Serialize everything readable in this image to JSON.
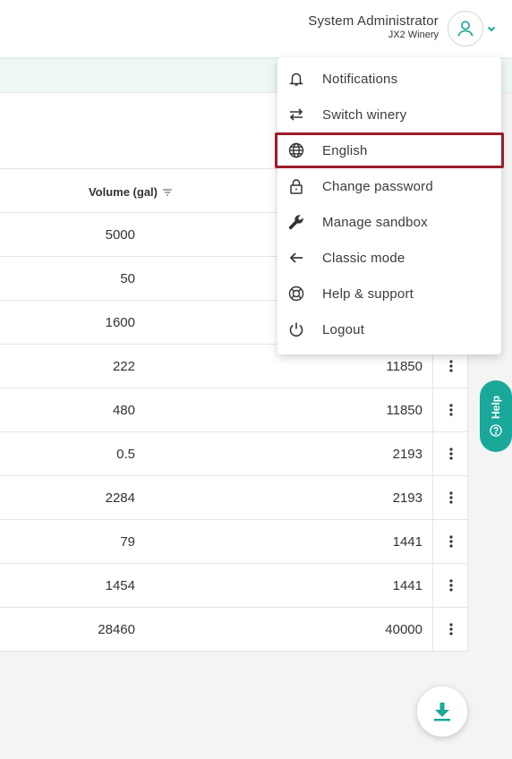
{
  "header": {
    "user_name": "System Administrator",
    "winery": "JX2 Winery"
  },
  "table": {
    "volume_header": "Volume (gal)",
    "rows": [
      {
        "volume": "5000",
        "other": ""
      },
      {
        "volume": "50",
        "other": ""
      },
      {
        "volume": "1600",
        "other": ""
      },
      {
        "volume": "222",
        "other": "11850"
      },
      {
        "volume": "480",
        "other": "11850"
      },
      {
        "volume": "0.5",
        "other": "2193"
      },
      {
        "volume": "2284",
        "other": "2193"
      },
      {
        "volume": "79",
        "other": "1441"
      },
      {
        "volume": "1454",
        "other": "1441"
      },
      {
        "volume": "28460",
        "other": "40000"
      }
    ]
  },
  "menu": {
    "items": [
      {
        "label": "Notifications",
        "icon": "bell-icon"
      },
      {
        "label": "Switch winery",
        "icon": "switch-icon"
      },
      {
        "label": "English",
        "icon": "globe-icon"
      },
      {
        "label": "Change password",
        "icon": "lock-icon"
      },
      {
        "label": "Manage sandbox",
        "icon": "wrench-icon"
      },
      {
        "label": "Classic mode",
        "icon": "arrow-left-icon"
      },
      {
        "label": "Help & support",
        "icon": "lifebuoy-icon"
      },
      {
        "label": "Logout",
        "icon": "power-icon"
      }
    ]
  },
  "help_tab": {
    "label": "Help"
  },
  "colors": {
    "accent": "#1aa89a",
    "highlight": "#9b1c2a"
  }
}
